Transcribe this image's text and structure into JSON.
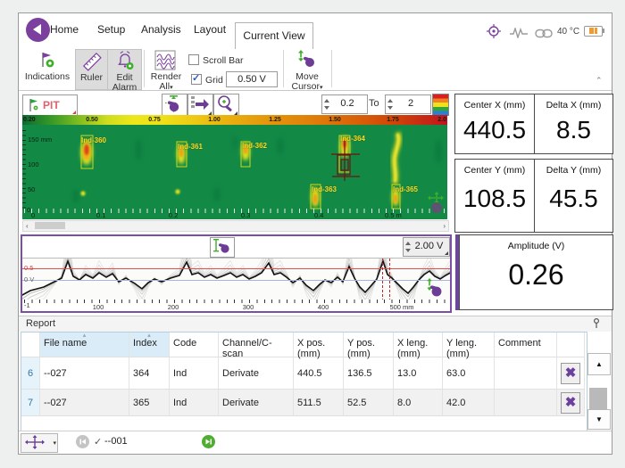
{
  "window": {
    "temperature": "40 °C"
  },
  "menu": {
    "items": [
      "Home",
      "Setup",
      "Analysis",
      "Layout"
    ],
    "active_tab": "Current View"
  },
  "toolbar": {
    "indications_label": "Indications",
    "ruler_label": "Ruler",
    "edit_alarm_label": "Edit Alarm",
    "render_all_label": "Render All",
    "scrollbar_label": "Scroll Bar",
    "grid_label": "Grid",
    "grid_value": "0.50 V",
    "move_cursor_label": "Move Cursor"
  },
  "cscan": {
    "channel_label": "PIT",
    "range_from": "0.2",
    "range_to_word": "To",
    "range_to": "2",
    "scale_ticks": [
      "0.20",
      "0.50",
      "0.75",
      "1.00",
      "1.25",
      "1.50",
      "1.75",
      "2.0"
    ],
    "y_axis_ticks": [
      "150 mm",
      "100",
      "50",
      "0"
    ],
    "x_axis_ticks": [
      "0",
      "0.1",
      "0.2",
      "0.3",
      "0.4",
      "0.5 m"
    ],
    "indications": [
      {
        "label": "Ind-360"
      },
      {
        "label": "Ind-361"
      },
      {
        "label": "Ind-362"
      },
      {
        "label": "Ind-363"
      },
      {
        "label": "Ind-364"
      },
      {
        "label": "Ind-365"
      }
    ]
  },
  "readouts": {
    "center_x": {
      "label": "Center X (mm)",
      "value": "440.5"
    },
    "delta_x": {
      "label": "Delta X (mm)",
      "value": "8.5"
    },
    "center_y": {
      "label": "Center Y (mm)",
      "value": "108.5"
    },
    "delta_y": {
      "label": "Delta Y (mm)",
      "value": "45.5"
    },
    "amplitude": {
      "label": "Amplitude (V)",
      "value": "0.26"
    }
  },
  "strip": {
    "scale_value": "2.00 V",
    "y_label_upper": "0.5",
    "y_label_zero": "0 V",
    "y_label_lower": "-1",
    "x_ticks": [
      "100",
      "200",
      "300",
      "400",
      "500 mm"
    ]
  },
  "report": {
    "title": "Report",
    "columns": [
      "File name",
      "Index",
      "Code",
      "Channel/C-scan",
      "X pos. (mm)",
      "Y pos. (mm)",
      "X leng. (mm)",
      "Y leng. (mm)",
      "Comment"
    ],
    "rows": [
      {
        "num": "6",
        "file_name": "--027",
        "index": "364",
        "code": "Ind",
        "channel": "Derivate",
        "x_pos": "440.5",
        "y_pos": "136.5",
        "x_leng": "13.0",
        "y_leng": "63.0",
        "comment": ""
      },
      {
        "num": "7",
        "file_name": "--027",
        "index": "365",
        "code": "Ind",
        "channel": "Derivate",
        "x_pos": "511.5",
        "y_pos": "52.5",
        "x_leng": "8.0",
        "y_leng": "42.0",
        "comment": ""
      }
    ]
  },
  "statusbar": {
    "file_label": "--001"
  },
  "icons": {
    "back": "circle-left-arrow",
    "target": "crosshair-target",
    "signal": "waveform",
    "link": "chain-link",
    "battery": "battery-partial",
    "indications": "flag-with-eye",
    "ruler": "diagonal-ruler",
    "edit_alarm": "bell-badge",
    "render_all": "waveform-box",
    "move_cursor": "hand-with-arrows",
    "pit": "green-flag",
    "pan_tool": "hand-with-arrows",
    "step_tool": "arrow-right-list",
    "zoom_tool": "magnifier-plus",
    "palette": "rainbow-palette",
    "pin": "pin",
    "delete_row": "cross",
    "move_tool": "four-way-arrows",
    "skip_prev": "skip-previous",
    "skip_next": "skip-next"
  },
  "colors": {
    "accent_purple": "#7b3f9e",
    "cscan_green": "#128a46",
    "indication_yellow": "#f5e41c",
    "alarm_text_red": "#e2606e",
    "battery_orange": "#f29a2e"
  }
}
